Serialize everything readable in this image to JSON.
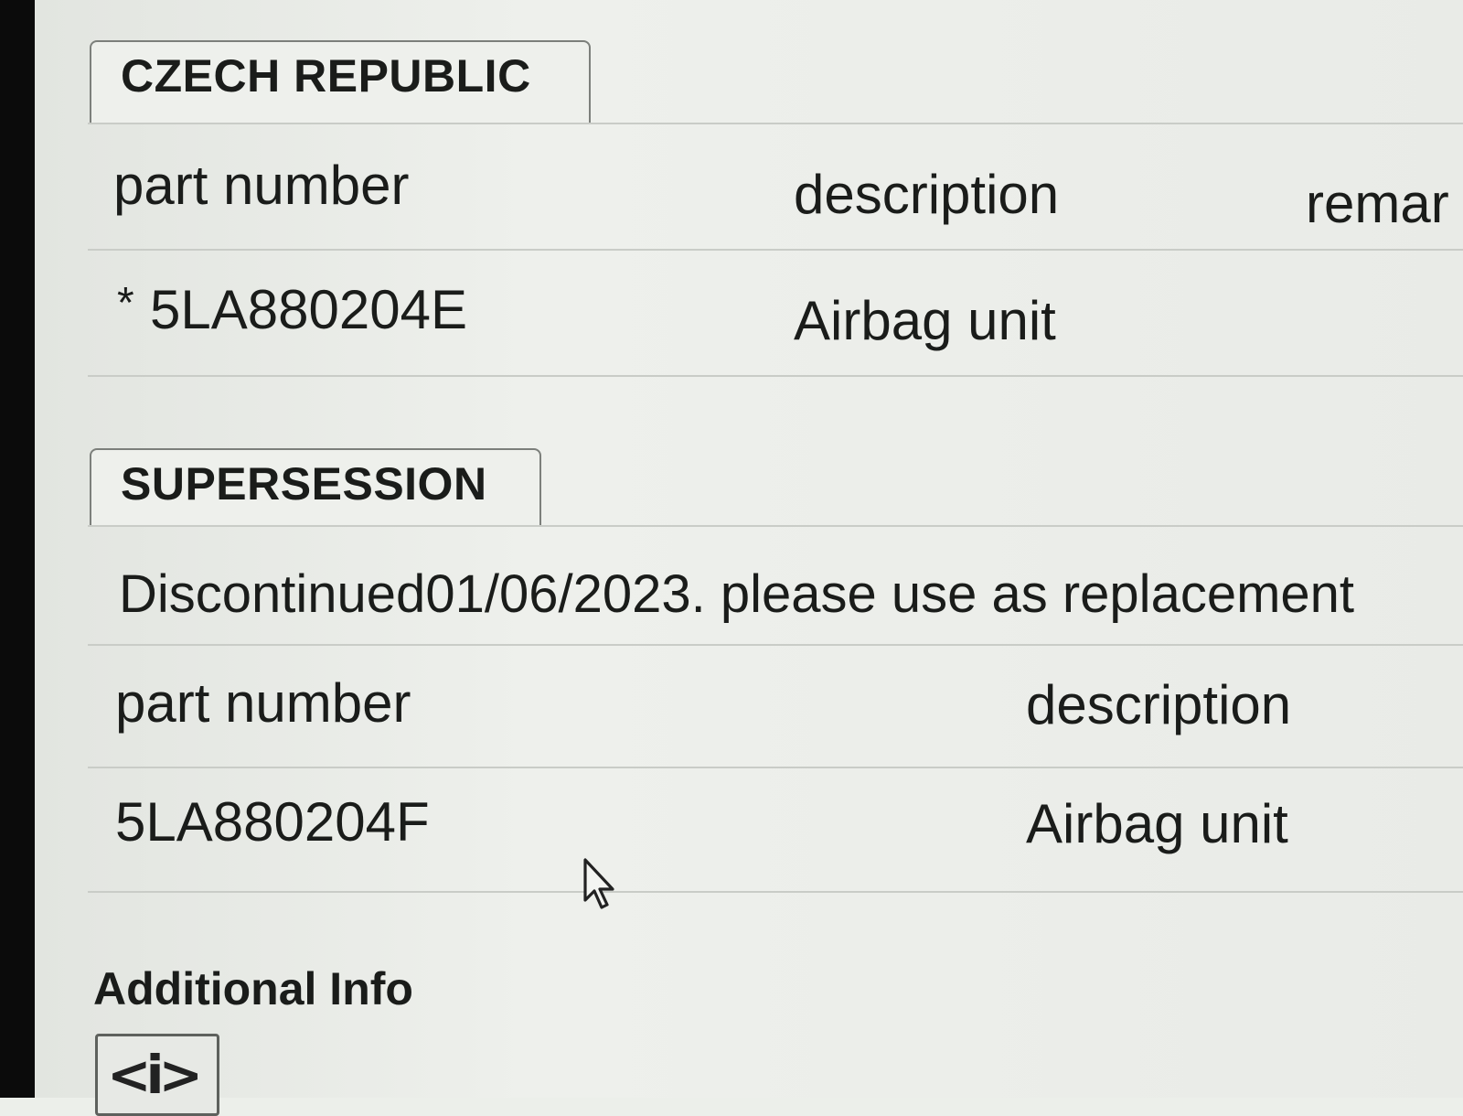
{
  "country_section": {
    "tab_label": "CZECH REPUBLIC",
    "columns": {
      "part_number": "part number",
      "description": "description",
      "remarks": "remar"
    },
    "row": {
      "marker": "*",
      "part_number": "5LA880204E",
      "description": "Airbag unit"
    }
  },
  "supersession_section": {
    "tab_label": "SUPERSESSION",
    "notice": "Discontinued01/06/2023. please use as replacement",
    "columns": {
      "part_number": "part number",
      "description": "description"
    },
    "row": {
      "part_number": "5LA880204F",
      "description": "Airbag unit"
    }
  },
  "additional_info": {
    "title": "Additional Info",
    "icon": "info-icon"
  }
}
